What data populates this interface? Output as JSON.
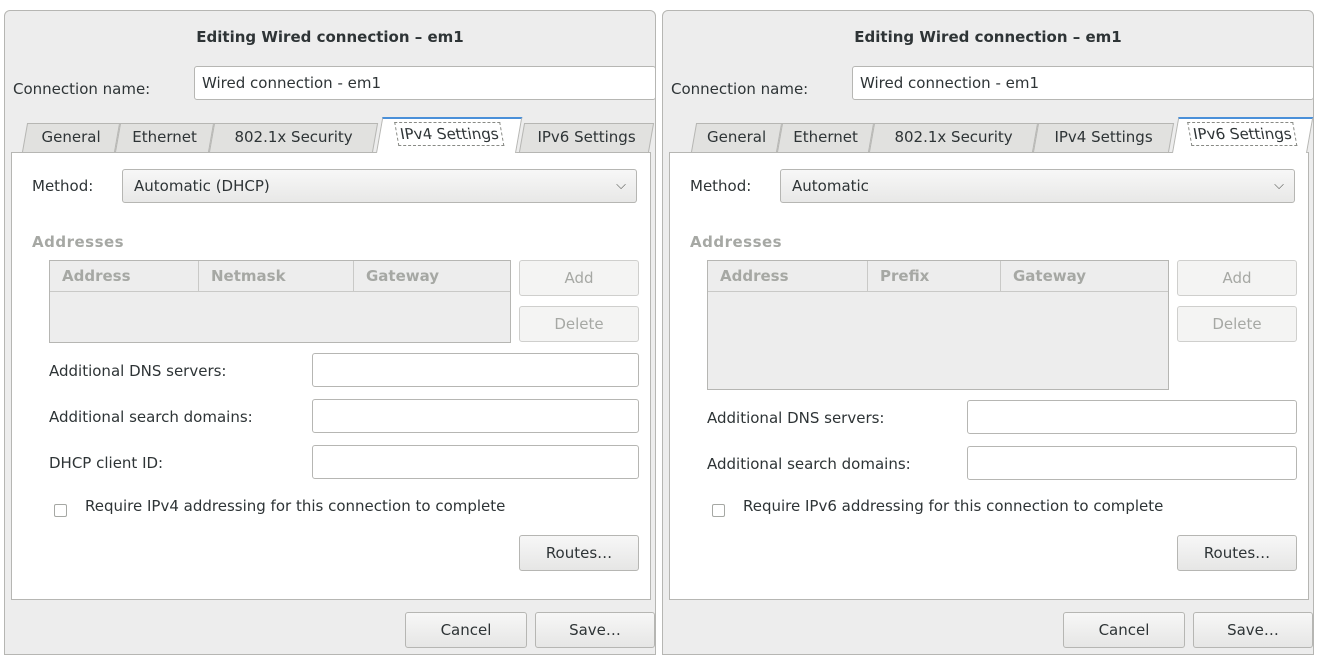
{
  "dialogs": {
    "left": {
      "title": "Editing Wired connection – em1",
      "connection_name_label": "Connection name:",
      "connection_name_value": "Wired connection - em1",
      "tabs": [
        "General",
        "Ethernet",
        "802.1x Security",
        "IPv4 Settings",
        "IPv6 Settings"
      ],
      "active_tab": "IPv4 Settings",
      "method_label": "Method:",
      "method_value": "Automatic (DHCP)",
      "addresses_heading": "Addresses",
      "columns": [
        "Address",
        "Netmask",
        "Gateway"
      ],
      "add_label": "Add",
      "delete_label": "Delete",
      "dns_label": "Additional DNS servers:",
      "search_label": "Additional search domains:",
      "dhcp_label": "DHCP client ID:",
      "require_label": "Require IPv4 addressing for this connection to complete",
      "routes_label": "Routes…",
      "cancel_label": "Cancel",
      "save_label": "Save…"
    },
    "right": {
      "title": "Editing Wired connection – em1",
      "connection_name_label": "Connection name:",
      "connection_name_value": "Wired connection - em1",
      "tabs": [
        "General",
        "Ethernet",
        "802.1x Security",
        "IPv4 Settings",
        "IPv6 Settings"
      ],
      "active_tab": "IPv6 Settings",
      "method_label": "Method:",
      "method_value": "Automatic",
      "addresses_heading": "Addresses",
      "columns": [
        "Address",
        "Prefix",
        "Gateway"
      ],
      "add_label": "Add",
      "delete_label": "Delete",
      "dns_label": "Additional DNS servers:",
      "search_label": "Additional search domains:",
      "require_label": "Require IPv6 addressing for this connection to complete",
      "routes_label": "Routes…",
      "cancel_label": "Cancel",
      "save_label": "Save…"
    }
  },
  "icons": {
    "dropdown": "chevron-down-icon"
  },
  "colors": {
    "accent": "#4a90d9",
    "window_bg": "#ededed",
    "border": "#b6b6b3",
    "muted_text": "#a6a8a4"
  }
}
